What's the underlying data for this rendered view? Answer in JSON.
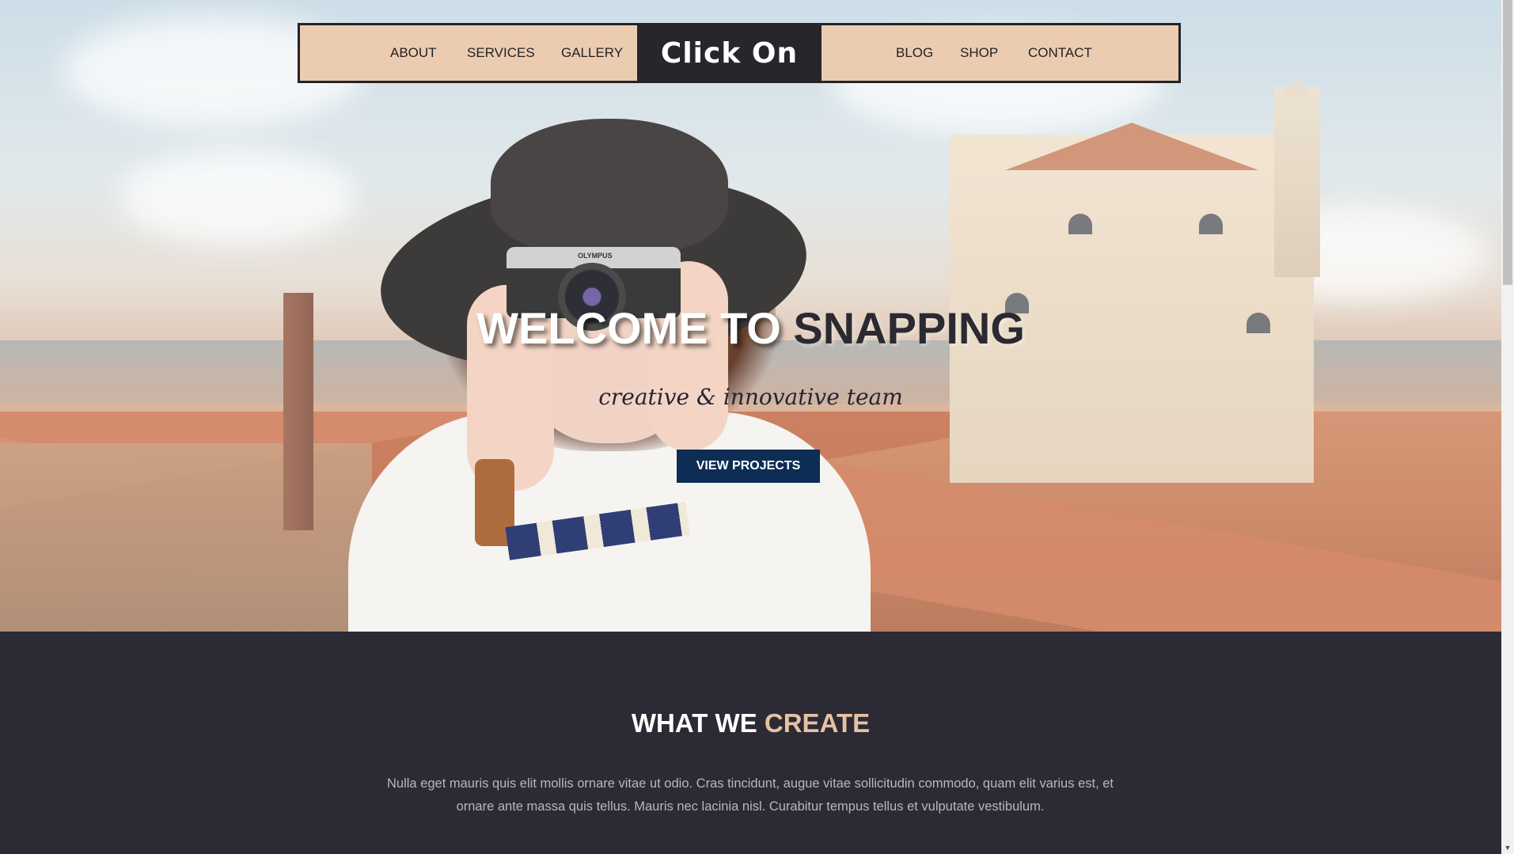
{
  "nav": {
    "left_links": [
      "ABOUT",
      "SERVICES",
      "GALLERY"
    ],
    "brand": "Click On",
    "right_links": [
      "BLOG",
      "SHOP",
      "CONTACT"
    ]
  },
  "hero": {
    "title_part1": "WELCOME TO ",
    "title_part2": "SNAPPING",
    "subtitle": "creative & innovative team",
    "cta_label": "VIEW PROJECTS",
    "camera_brand": "OLYMPUS"
  },
  "section": {
    "title_part1": "WHAT WE ",
    "title_part2": "CREATE",
    "text": "Nulla eget mauris quis elit mollis ornare vitae ut odio. Cras tincidunt, augue vitae sollicitudin commodo, quam elit varius est, et ornare ante massa quis tellus. Mauris nec lacinia nisl. Curabitur tempus tellus et vulputate vestibulum."
  },
  "colors": {
    "nav_bg": "#ecccb0",
    "brand_bg": "#27262d",
    "cta_bg": "#0d2d55",
    "dark_section": "#2c2a34",
    "accent_peach": "#e4c2a3"
  },
  "icons": {
    "scroll_up": "scroll-up-arrow",
    "scroll_down": "scroll-down-arrow"
  }
}
